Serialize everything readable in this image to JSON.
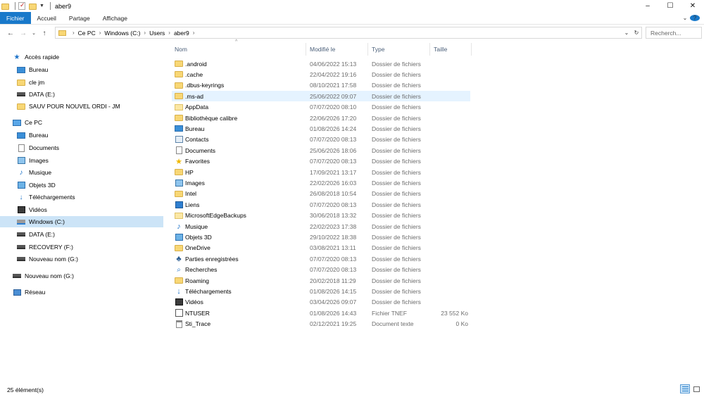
{
  "window": {
    "title": "aber9",
    "controls": {
      "minimize": "–",
      "maximize": "☐",
      "close": "✕"
    }
  },
  "ribbon": {
    "tabs": [
      "Fichier",
      "Accueil",
      "Partage",
      "Affichage"
    ],
    "expand": "⌄",
    "help": "?"
  },
  "nav": {
    "back": "←",
    "forward": "→",
    "recent": "⌄",
    "up": "↑"
  },
  "address": {
    "crumbs": [
      "Ce PC",
      "Windows (C:)",
      "Users",
      "aber9"
    ],
    "dropdown": "⌄",
    "refresh": "↻"
  },
  "search": {
    "placeholder": "Recherch..."
  },
  "sidebar": {
    "quick_access": {
      "label": "Accès rapide",
      "items": [
        {
          "label": "Bureau",
          "icon": "desktop-folder-icon"
        },
        {
          "label": "cle jm",
          "icon": "folder-icon"
        },
        {
          "label": "DATA (E:)",
          "icon": "drive-icon"
        },
        {
          "label": "SAUV POUR NOUVEL ORDI - JM",
          "icon": "folder-icon"
        }
      ]
    },
    "this_pc": {
      "label": "Ce PC",
      "items": [
        {
          "label": "Bureau",
          "icon": "desktop-folder-icon"
        },
        {
          "label": "Documents",
          "icon": "documents-icon"
        },
        {
          "label": "Images",
          "icon": "pictures-icon"
        },
        {
          "label": "Musique",
          "icon": "music-icon"
        },
        {
          "label": "Objets 3D",
          "icon": "objects-3d-icon"
        },
        {
          "label": "Téléchargements",
          "icon": "downloads-icon"
        },
        {
          "label": "Vidéos",
          "icon": "videos-icon"
        },
        {
          "label": "Windows (C:)",
          "icon": "windows-drive-icon",
          "selected": true
        },
        {
          "label": "DATA (E:)",
          "icon": "drive-icon"
        },
        {
          "label": "RECOVERY (F:)",
          "icon": "drive-icon"
        },
        {
          "label": "Nouveau nom (G:)",
          "icon": "drive-icon"
        }
      ]
    },
    "extra_drive": {
      "label": "Nouveau nom (G:)",
      "icon": "drive-icon"
    },
    "network": {
      "label": "Réseau",
      "icon": "network-icon"
    }
  },
  "columns": {
    "name": "Nom",
    "modified": "Modifié le",
    "type": "Type",
    "size": "Taille"
  },
  "files": [
    {
      "name": ".android",
      "date": "04/06/2022 15:13",
      "type": "Dossier de fichiers",
      "size": "",
      "icon": "folder"
    },
    {
      "name": ".cache",
      "date": "22/04/2022 19:16",
      "type": "Dossier de fichiers",
      "size": "",
      "icon": "folder"
    },
    {
      "name": ".dbus-keyrings",
      "date": "08/10/2021 17:58",
      "type": "Dossier de fichiers",
      "size": "",
      "icon": "folder"
    },
    {
      "name": ".ms-ad",
      "date": "25/06/2022 09:07",
      "type": "Dossier de fichiers",
      "size": "",
      "icon": "folder",
      "hover": true
    },
    {
      "name": "AppData",
      "date": "07/07/2020 08:10",
      "type": "Dossier de fichiers",
      "size": "",
      "icon": "folder-light"
    },
    {
      "name": "Bibliothèque calibre",
      "date": "22/06/2026 17:20",
      "type": "Dossier de fichiers",
      "size": "",
      "icon": "folder"
    },
    {
      "name": "Bureau",
      "date": "01/08/2026 14:24",
      "type": "Dossier de fichiers",
      "size": "",
      "icon": "desktop"
    },
    {
      "name": "Contacts",
      "date": "07/07/2020 08:13",
      "type": "Dossier de fichiers",
      "size": "",
      "icon": "contacts"
    },
    {
      "name": "Documents",
      "date": "25/06/2026 18:06",
      "type": "Dossier de fichiers",
      "size": "",
      "icon": "documents"
    },
    {
      "name": "Favorites",
      "date": "07/07/2020 08:13",
      "type": "Dossier de fichiers",
      "size": "",
      "icon": "favorites"
    },
    {
      "name": "HP",
      "date": "17/09/2021 13:17",
      "type": "Dossier de fichiers",
      "size": "",
      "icon": "folder"
    },
    {
      "name": "Images",
      "date": "22/02/2026 16:03",
      "type": "Dossier de fichiers",
      "size": "",
      "icon": "pictures"
    },
    {
      "name": "Intel",
      "date": "26/08/2018 10:54",
      "type": "Dossier de fichiers",
      "size": "",
      "icon": "folder"
    },
    {
      "name": "Liens",
      "date": "07/07/2020 08:13",
      "type": "Dossier de fichiers",
      "size": "",
      "icon": "links"
    },
    {
      "name": "MicrosoftEdgeBackups",
      "date": "30/06/2018 13:32",
      "type": "Dossier de fichiers",
      "size": "",
      "icon": "folder-light"
    },
    {
      "name": "Musique",
      "date": "22/02/2023 17:38",
      "type": "Dossier de fichiers",
      "size": "",
      "icon": "music"
    },
    {
      "name": "Objets 3D",
      "date": "29/10/2022 18:38",
      "type": "Dossier de fichiers",
      "size": "",
      "icon": "objects3d"
    },
    {
      "name": "OneDrive",
      "date": "03/08/2021 13:11",
      "type": "Dossier de fichiers",
      "size": "",
      "icon": "folder"
    },
    {
      "name": "Parties enregistrées",
      "date": "07/07/2020 08:13",
      "type": "Dossier de fichiers",
      "size": "",
      "icon": "saved-games"
    },
    {
      "name": "Recherches",
      "date": "07/07/2020 08:13",
      "type": "Dossier de fichiers",
      "size": "",
      "icon": "searches"
    },
    {
      "name": "Roaming",
      "date": "20/02/2018 11:29",
      "type": "Dossier de fichiers",
      "size": "",
      "icon": "folder"
    },
    {
      "name": "Téléchargements",
      "date": "01/08/2026 14:15",
      "type": "Dossier de fichiers",
      "size": "",
      "icon": "downloads"
    },
    {
      "name": "Vidéos",
      "date": "03/04/2026 09:07",
      "type": "Dossier de fichiers",
      "size": "",
      "icon": "videos"
    },
    {
      "name": "NTUSER",
      "date": "01/08/2026 14:43",
      "type": "Fichier TNEF",
      "size": "23 552 Ko",
      "icon": "ntuser"
    },
    {
      "name": "Sti_Trace",
      "date": "02/12/2021 19:25",
      "type": "Document texte",
      "size": "0 Ko",
      "icon": "text"
    }
  ],
  "status": {
    "count": "25 élément(s)"
  },
  "colors": {
    "accent": "#1979ca",
    "selection": "#cce4f7",
    "hover": "#e5f3ff",
    "folder": "#f8d775"
  }
}
